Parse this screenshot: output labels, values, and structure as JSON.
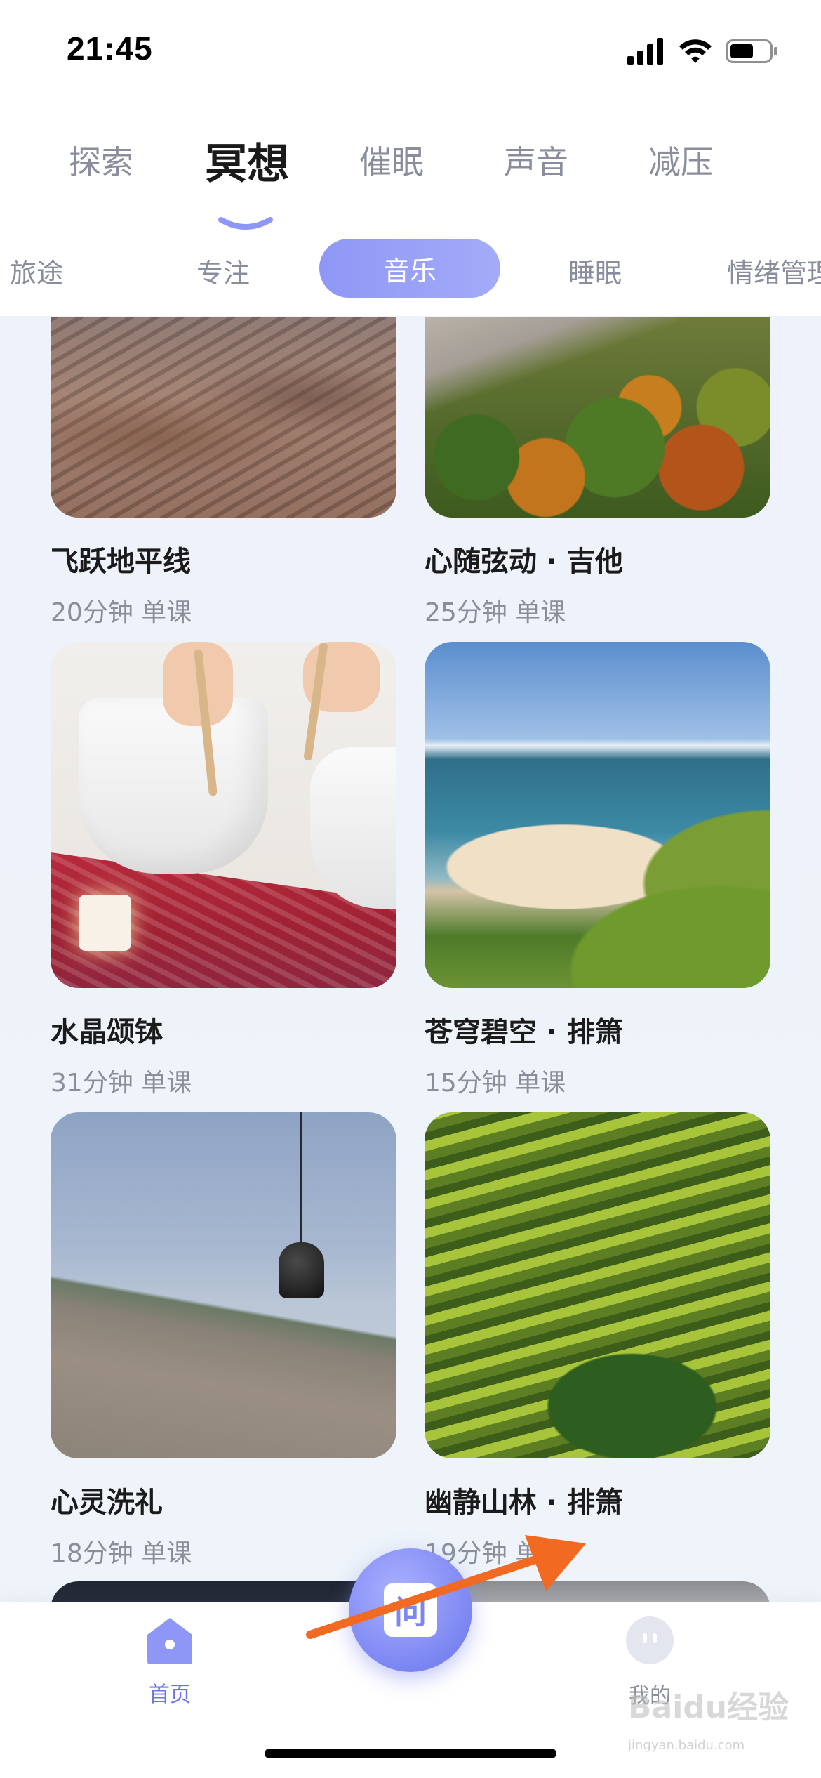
{
  "status_bar": {
    "time": "21:45",
    "icons": [
      "signal-icon",
      "wifi-icon",
      "battery-icon"
    ]
  },
  "main_tabs": [
    {
      "label": "探索",
      "active": false
    },
    {
      "label": "冥想",
      "active": true
    },
    {
      "label": "催眠",
      "active": false
    },
    {
      "label": "声音",
      "active": false
    },
    {
      "label": "减压",
      "active": false
    }
  ],
  "sub_tabs": [
    {
      "label": "旅途",
      "active": false
    },
    {
      "label": "专注",
      "active": false
    },
    {
      "label": "音乐",
      "active": true
    },
    {
      "label": "睡眠",
      "active": false
    },
    {
      "label": "情绪管理",
      "active": false
    }
  ],
  "cards": [
    {
      "title": "飞跃地平线",
      "meta": "20分钟 单课",
      "image": "desert-mountains-aerial"
    },
    {
      "title": "心随弦动 · 吉他",
      "meta": "25分钟 单课",
      "image": "autumn-forest"
    },
    {
      "title": "水晶颂钵",
      "meta": "31分钟 单课",
      "image": "crystal-singing-bowls"
    },
    {
      "title": "苍穹碧空 · 排箫",
      "meta": "15分钟 单课",
      "image": "coastline-beach"
    },
    {
      "title": "心灵洗礼",
      "meta": "18分钟 单课",
      "image": "wind-bell"
    },
    {
      "title": "幽静山林 · 排箫",
      "meta": "19分钟 单课",
      "image": "rice-terraces"
    }
  ],
  "tab_bar": {
    "home_label": "首页",
    "center_glyph": "问",
    "me_label": "我的"
  },
  "watermark": {
    "text": "Baidu经验",
    "sub": "jingyan.baidu.com"
  },
  "colors": {
    "accent": "#8e97f6",
    "arrow": "#f26a21",
    "active_text": "#1a1a1a",
    "inactive_text": "#8a8d9d"
  }
}
